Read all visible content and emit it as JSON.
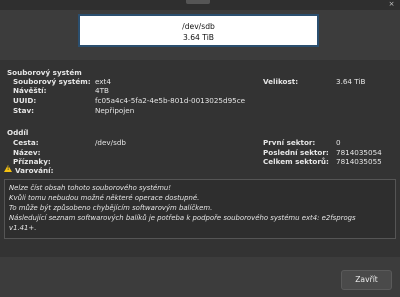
{
  "titlebar": {
    "close_glyph": "×"
  },
  "disk": {
    "path": "/dev/sdb",
    "size": "3.64 TiB"
  },
  "filesystem": {
    "section_title": "Souborový systém",
    "fs_label": "Souborový systém:",
    "fs_value": "ext4",
    "name_label": "Návěští:",
    "name_value": "4TB",
    "uuid_label": "UUID:",
    "uuid_value": "fc05a4c4-5fa2-4e5b-801d-0013025d95ce",
    "status_label": "Stav:",
    "status_value": "Nepřipojen",
    "size_label": "Velikost:",
    "size_value": "3.64 TiB"
  },
  "partition": {
    "section_title": "Oddíl",
    "path_label": "Cesta:",
    "path_value": "/dev/sdb",
    "name_label": "Název:",
    "name_value": "",
    "flags_label": "Příznaky:",
    "flags_value": "",
    "first_sector_label": "První sektor:",
    "first_sector_value": "0",
    "last_sector_label": "Poslední sektor:",
    "last_sector_value": "7814035054",
    "total_sectors_label": "Celkem sektorů:",
    "total_sectors_value": "7814035055"
  },
  "warning": {
    "title": "Varování:",
    "lines": [
      "Nelze číst obsah tohoto souborového systému!",
      "Kvůli tomu nebudou možné některé operace dostupné.",
      "To může být způsobeno chybějícím softwarovým balíčkem.",
      "Následující seznam softwarových balíků je potřeba k podpoře souborového systému ext4: e2fsprogs",
      "v1.41+."
    ]
  },
  "buttons": {
    "close_label": "Zavřít"
  }
}
